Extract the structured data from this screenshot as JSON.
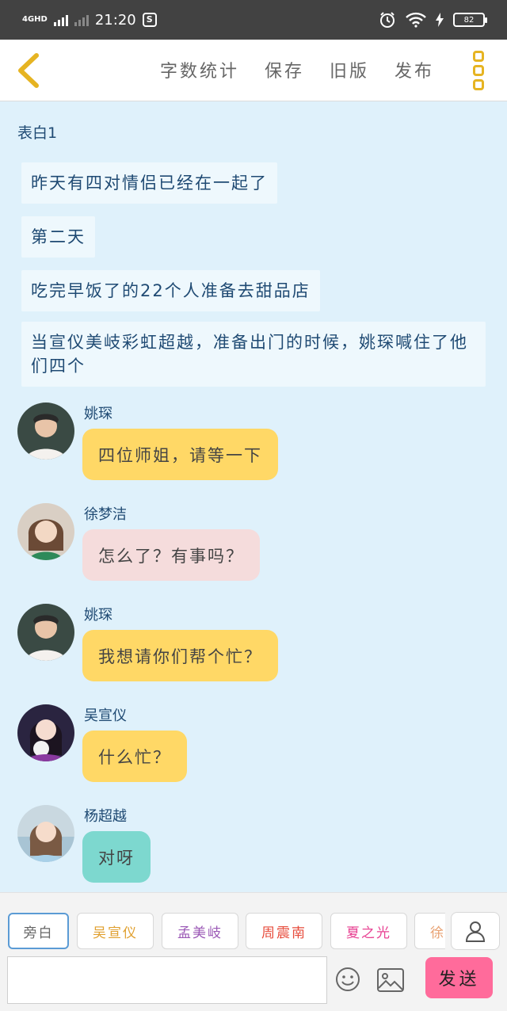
{
  "status_bar": {
    "network": "4GHD",
    "time": "21:20",
    "battery": "82"
  },
  "nav": {
    "actions": [
      "字数统计",
      "保存",
      "旧版",
      "发布"
    ]
  },
  "story": {
    "chapter_title": "表白1",
    "narrations": [
      "昨天有四对情侣已经在一起了",
      "第二天",
      "吃完早饭了的22个人准备去甜品店",
      "当宣仪美岐彩虹超越，准备出门的时候，姚琛喊住了他们四个"
    ],
    "messages": [
      {
        "name": "姚琛",
        "text": "四位师姐，请等一下",
        "color": "yellow"
      },
      {
        "name": "徐梦洁",
        "text": "怎么了？有事吗？",
        "color": "pink"
      },
      {
        "name": "姚琛",
        "text": "我想请你们帮个忙？",
        "color": "yellow"
      },
      {
        "name": "吴宣仪",
        "text": "什么忙？",
        "color": "yellow"
      },
      {
        "name": "杨超越",
        "text": "对呀",
        "color": "teal"
      }
    ]
  },
  "bottom": {
    "characters": [
      {
        "label": "旁白",
        "color": "#666666"
      },
      {
        "label": "吴宣仪",
        "color": "#e0a030"
      },
      {
        "label": "孟美岐",
        "color": "#9b59b6"
      },
      {
        "label": "周震南",
        "color": "#e74c3c"
      },
      {
        "label": "夏之光",
        "color": "#e84393"
      },
      {
        "label": "徐梦洁",
        "color": "#e8a070"
      }
    ],
    "send_label": "发送"
  }
}
